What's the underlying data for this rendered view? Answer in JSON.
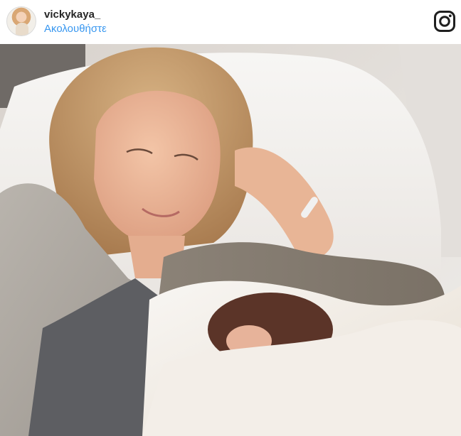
{
  "post": {
    "username": "vickykaya_",
    "follow_label": "Ακολουθήστε",
    "avatar": "profile-avatar",
    "logo_icon": "instagram-icon",
    "link_color": "#3897f0"
  }
}
